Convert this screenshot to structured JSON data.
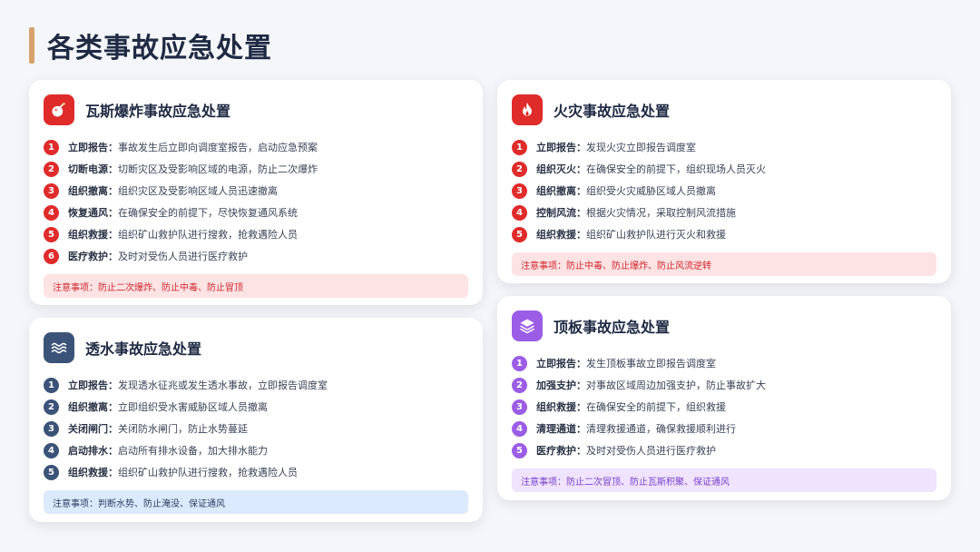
{
  "page": {
    "title": "各类事故应急处置"
  },
  "colors": {
    "accent_bar": "#d7a36d",
    "red": "#e02b2b",
    "navy": "#3b5378",
    "purple": "#9b5de5"
  },
  "cards": {
    "gas": {
      "icon": "bomb-icon",
      "title": "瓦斯爆炸事故应急处置",
      "steps": [
        {
          "num": "1",
          "label": "立即报告：",
          "text": "事故发生后立即向调度室报告，启动应急预案"
        },
        {
          "num": "2",
          "label": "切断电源：",
          "text": "切断灾区及受影响区域的电源，防止二次爆炸"
        },
        {
          "num": "3",
          "label": "组织撤离：",
          "text": "组织灾区及受影响区域人员迅速撤离"
        },
        {
          "num": "4",
          "label": "恢复通风：",
          "text": "在确保安全的前提下，尽快恢复通风系统"
        },
        {
          "num": "5",
          "label": "组织救援：",
          "text": "组织矿山救护队进行搜救，抢救遇险人员"
        },
        {
          "num": "6",
          "label": "医疗救护：",
          "text": "及时对受伤人员进行医疗救护"
        }
      ],
      "notice": "注意事项：防止二次爆炸、防止中毒、防止冒顶"
    },
    "fire": {
      "icon": "fire-icon",
      "title": "火灾事故应急处置",
      "steps": [
        {
          "num": "1",
          "label": "立即报告：",
          "text": "发现火灾立即报告调度室"
        },
        {
          "num": "2",
          "label": "组织灭火：",
          "text": "在确保安全的前提下，组织现场人员灭火"
        },
        {
          "num": "3",
          "label": "组织撤离：",
          "text": "组织受火灾威胁区域人员撤离"
        },
        {
          "num": "4",
          "label": "控制风流：",
          "text": "根据火灾情况，采取控制风流措施"
        },
        {
          "num": "5",
          "label": "组织救援：",
          "text": "组织矿山救护队进行灭火和救援"
        }
      ],
      "notice": "注意事项：防止中毒、防止爆炸、防止风流逆转"
    },
    "water": {
      "icon": "water-waves-icon",
      "title": "透水事故应急处置",
      "steps": [
        {
          "num": "1",
          "label": "立即报告：",
          "text": "发现透水征兆或发生透水事故，立即报告调度室"
        },
        {
          "num": "2",
          "label": "组织撤离：",
          "text": "立即组织受水害威胁区域人员撤离"
        },
        {
          "num": "3",
          "label": "关闭闸门：",
          "text": "关闭防水闸门，防止水势蔓延"
        },
        {
          "num": "4",
          "label": "启动排水：",
          "text": "启动所有排水设备，加大排水能力"
        },
        {
          "num": "5",
          "label": "组织救援：",
          "text": "组织矿山救护队进行搜救，抢救遇险人员"
        }
      ],
      "notice": "注意事项：判断水势、防止淹没、保证通风"
    },
    "roof": {
      "icon": "layers-icon",
      "title": "顶板事故应急处置",
      "steps": [
        {
          "num": "1",
          "label": "立即报告：",
          "text": "发生顶板事故立即报告调度室"
        },
        {
          "num": "2",
          "label": "加强支护：",
          "text": "对事故区域周边加强支护，防止事故扩大"
        },
        {
          "num": "3",
          "label": "组织救援：",
          "text": "在确保安全的前提下，组织救援"
        },
        {
          "num": "4",
          "label": "清理通道：",
          "text": "清理救援通道，确保救援顺利进行"
        },
        {
          "num": "5",
          "label": "医疗救护：",
          "text": "及时对受伤人员进行医疗救护"
        }
      ],
      "notice": "注意事项：防止二次冒顶、防止瓦斯积聚、保证通风"
    }
  }
}
